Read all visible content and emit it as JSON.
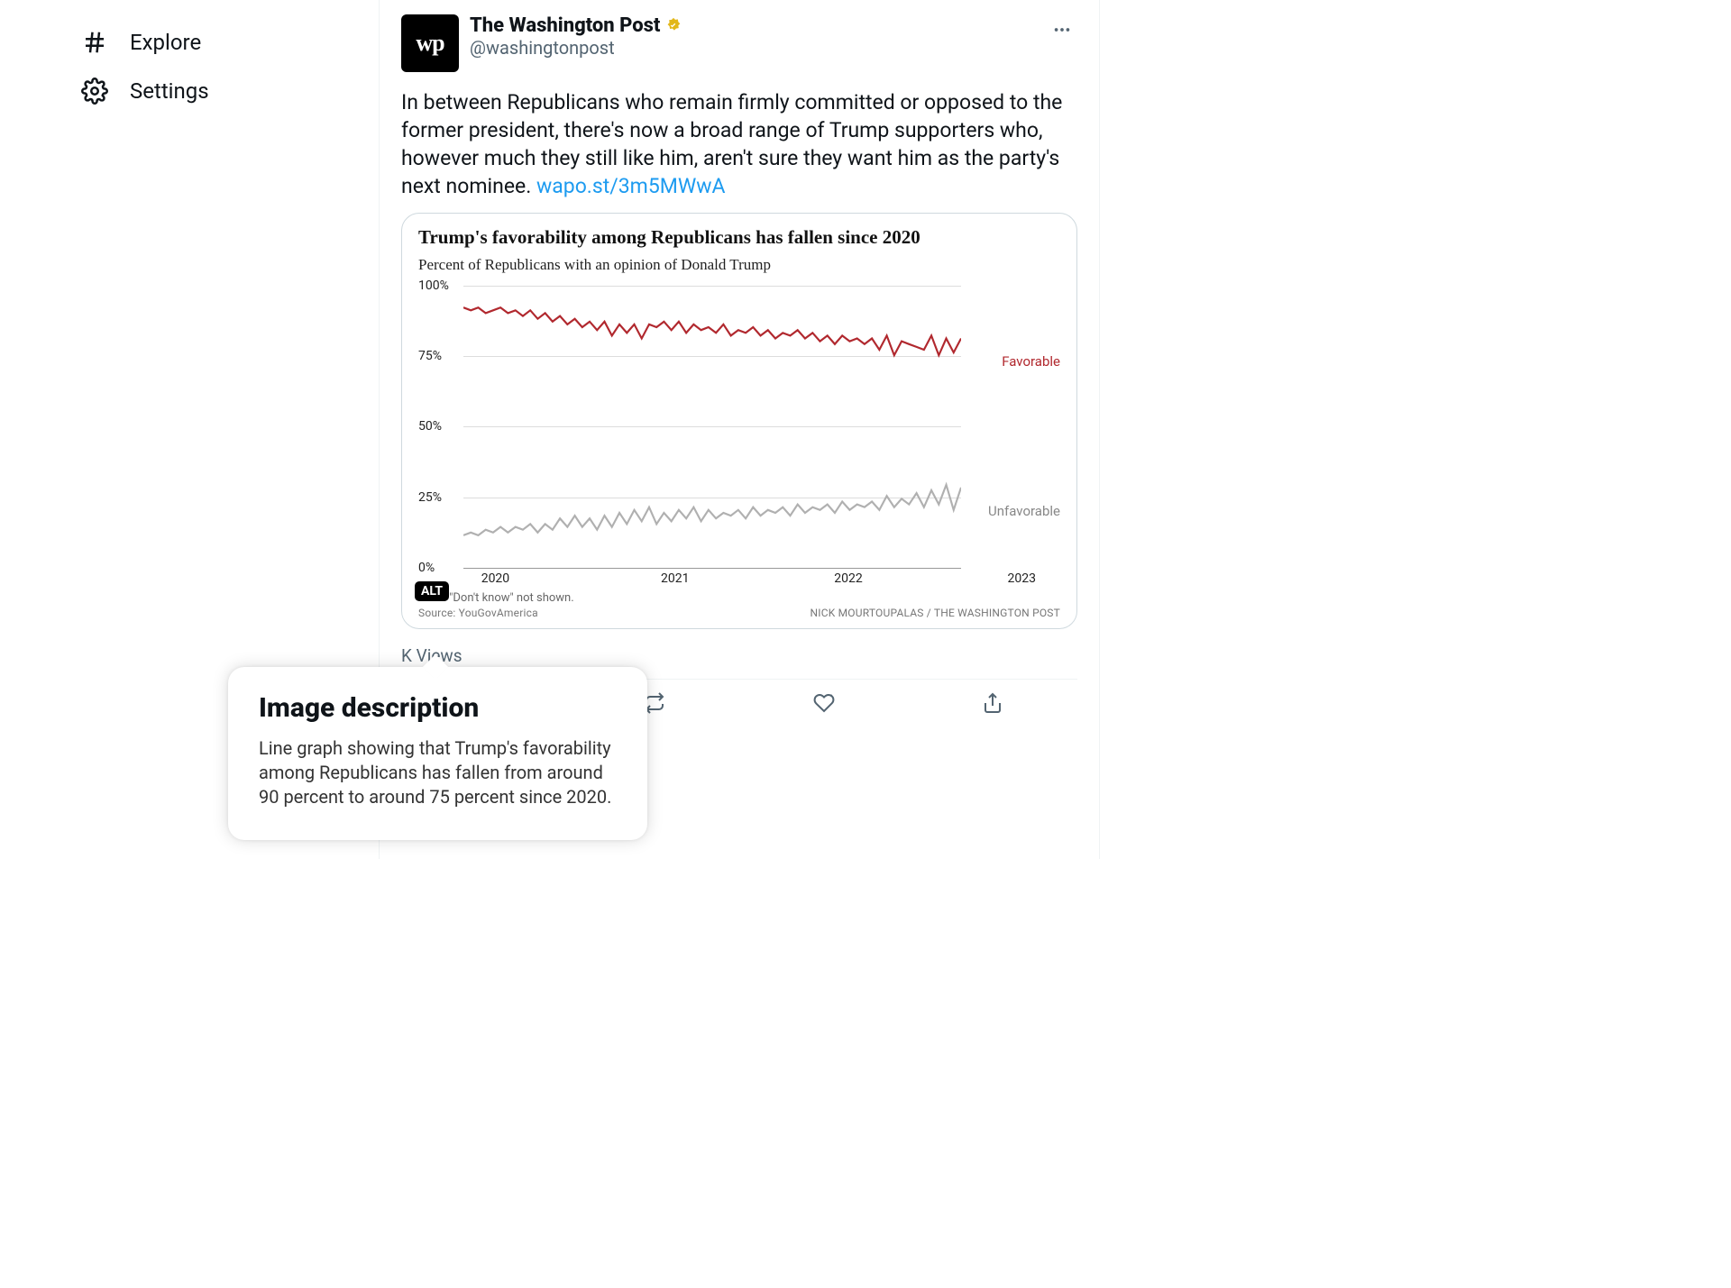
{
  "sidebar": {
    "items": [
      {
        "label": "Explore",
        "icon": "hash"
      },
      {
        "label": "Settings",
        "icon": "gear"
      }
    ]
  },
  "tweet": {
    "avatar_text": "wp",
    "author_name": "The Washington Post",
    "author_handle": "@washingtonpost",
    "verified": true,
    "body_text": "In between Republicans who remain firmly committed or opposed to the former president, there's now a broad range of Trump supporters who, however much they still like him, aren't sure they want him as the party's next nominee. ",
    "link_text": "wapo.st/3m5MWwA",
    "views_suffix": "K Views"
  },
  "chart_labels": {
    "title": "Trump's favorability among Republicans has fallen since 2020",
    "subtitle": "Percent of Republicans with an opinion of Donald Trump",
    "y_ticks": [
      "100%",
      "75%",
      "50%",
      "25%",
      "0%"
    ],
    "x_ticks": [
      "2020",
      "2021",
      "2022",
      "2023"
    ],
    "series_fav": "Favorable",
    "series_unfav": "Unfavorable",
    "note": "Note: \"Don't know\" not shown.",
    "source": "Source: YouGovAmerica",
    "credit": "NICK MOURTOUPALAS / THE WASHINGTON POST",
    "alt_badge": "ALT"
  },
  "alt_popover": {
    "title": "Image description",
    "body": "Line graph showing that Trump's favorability among Republicans has fallen from around 90 percent to around 75 percent since 2020."
  },
  "chart_data": {
    "type": "line",
    "xlabel": "",
    "ylabel": "Percent",
    "ylim": [
      0,
      100
    ],
    "x_range": [
      "2020",
      "2023"
    ],
    "series": [
      {
        "name": "Favorable",
        "color": "#b1282e",
        "values": [
          90,
          89,
          90,
          88,
          89,
          90,
          88,
          89,
          87,
          89,
          86,
          88,
          85,
          87,
          84,
          86,
          83,
          85,
          82,
          85,
          80,
          84,
          81,
          84,
          79,
          84,
          83,
          85,
          82,
          85,
          81,
          84,
          82,
          83,
          81,
          84,
          80,
          82,
          81,
          83,
          80,
          82,
          79,
          81,
          80,
          82,
          79,
          81,
          78,
          80,
          77,
          80,
          78,
          79,
          77,
          79,
          75,
          80,
          73,
          78,
          77,
          76,
          75,
          80,
          73,
          79,
          74,
          79
        ]
      },
      {
        "name": "Unfavorable",
        "color": "#b0b0b0",
        "values": [
          9,
          10,
          9,
          11,
          10,
          12,
          10,
          12,
          11,
          13,
          10,
          13,
          11,
          15,
          12,
          16,
          12,
          15,
          11,
          16,
          12,
          17,
          13,
          18,
          14,
          19,
          13,
          17,
          14,
          18,
          15,
          19,
          14,
          18,
          15,
          17,
          16,
          18,
          15,
          19,
          16,
          18,
          17,
          19,
          16,
          20,
          17,
          19,
          18,
          20,
          17,
          21,
          18,
          20,
          19,
          21,
          18,
          23,
          19,
          22,
          20,
          24,
          19,
          25,
          20,
          27,
          18,
          26
        ]
      }
    ]
  }
}
